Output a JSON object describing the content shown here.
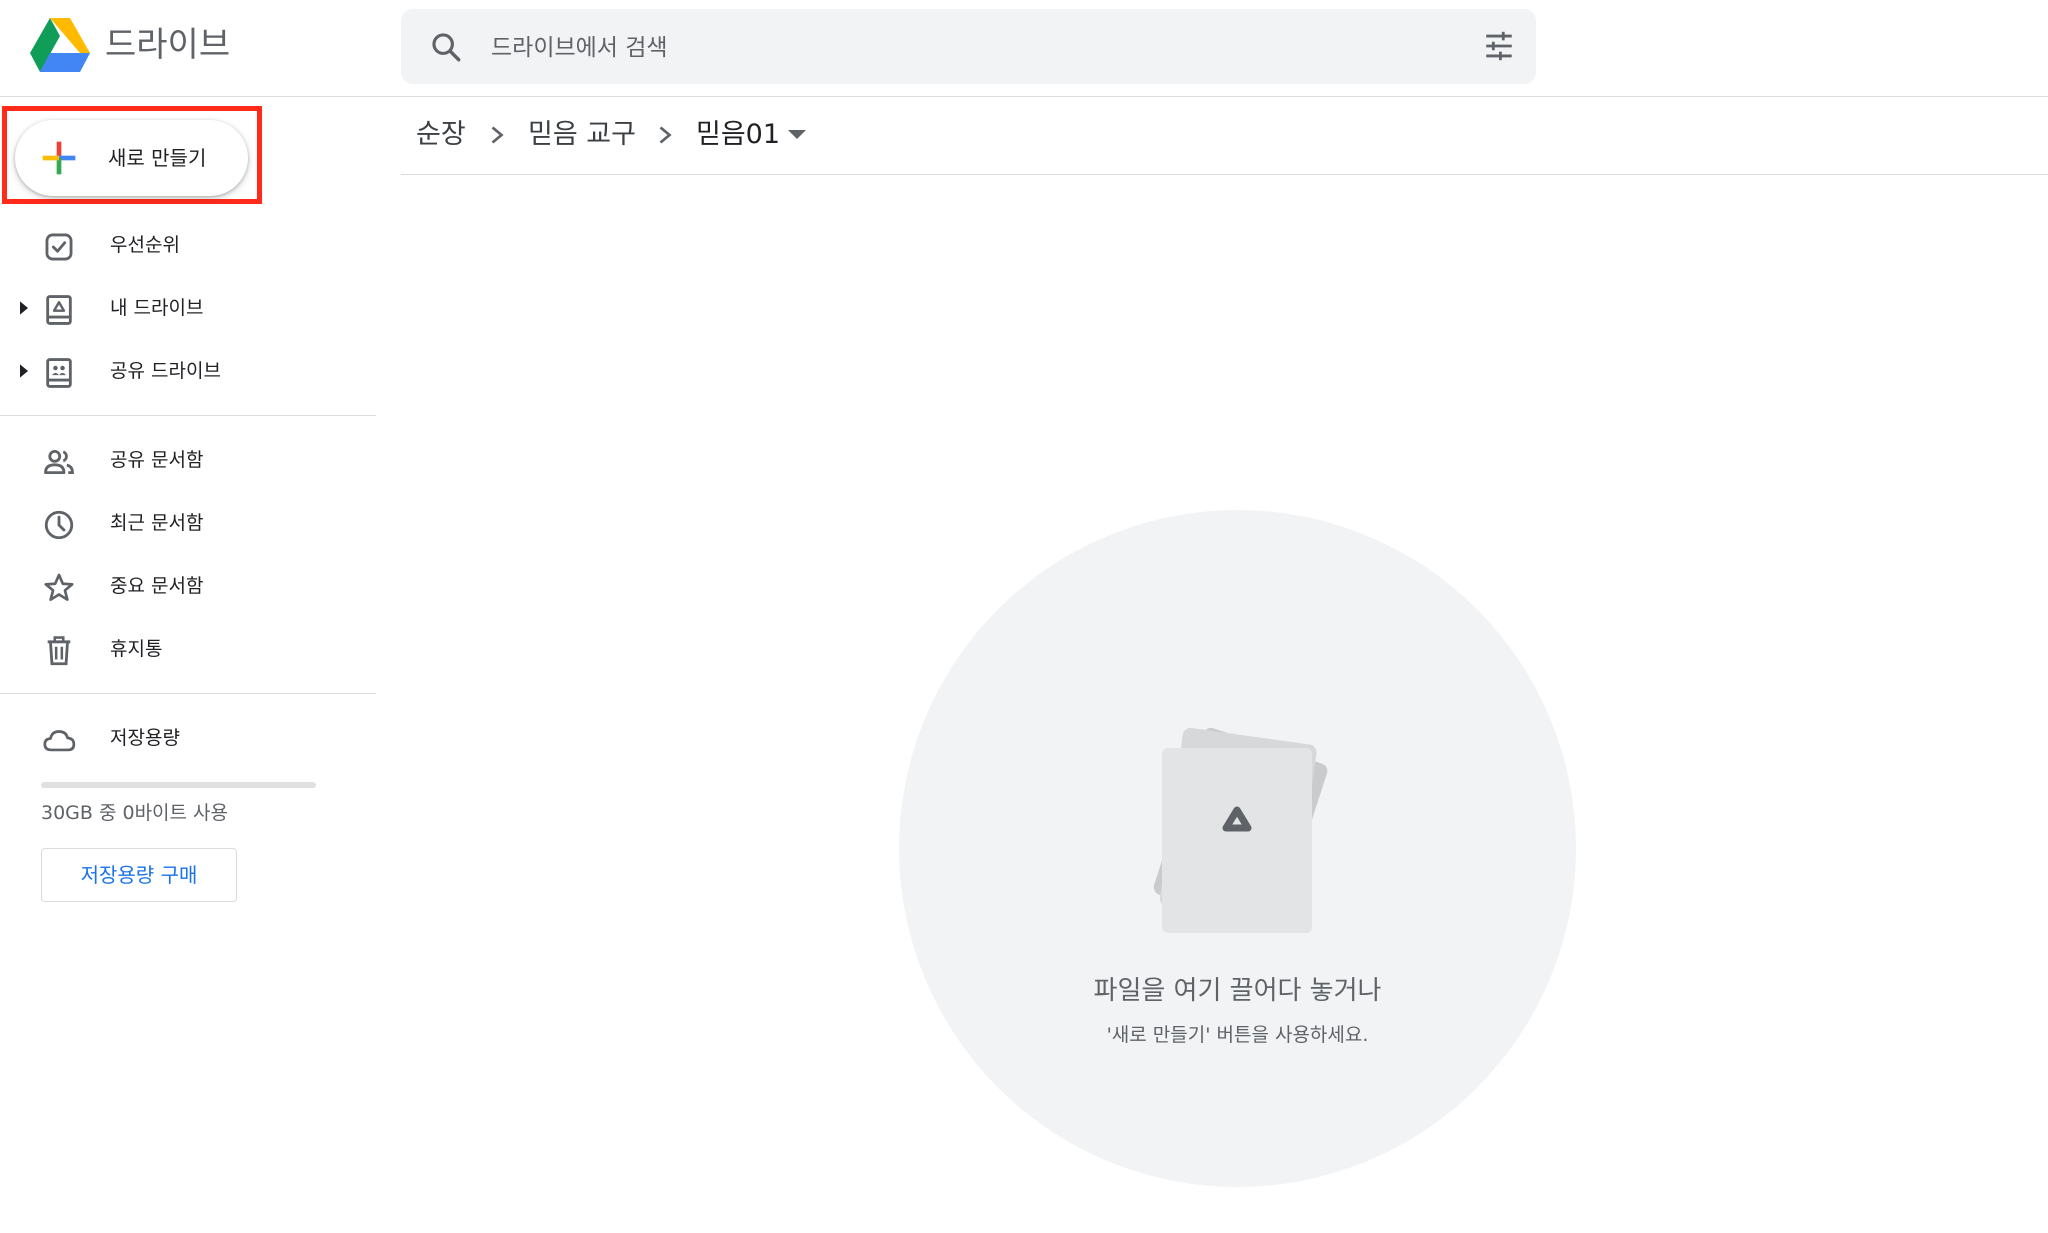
{
  "app": {
    "name": "드라이브"
  },
  "search": {
    "placeholder": "드라이브에서 검색"
  },
  "new_button": {
    "label": "새로 만들기"
  },
  "sidebar": {
    "items": [
      {
        "label": "우선순위",
        "icon": "priority-check-icon"
      },
      {
        "label": "내 드라이브",
        "icon": "my-drive-icon"
      },
      {
        "label": "공유 드라이브",
        "icon": "shared-drives-icon"
      },
      {
        "label": "공유 문서함",
        "icon": "people-icon"
      },
      {
        "label": "최근 문서함",
        "icon": "clock-icon"
      },
      {
        "label": "중요 문서함",
        "icon": "star-icon"
      },
      {
        "label": "휴지통",
        "icon": "trash-icon"
      },
      {
        "label": "저장용량",
        "icon": "cloud-icon"
      }
    ]
  },
  "storage": {
    "used_text": "30GB 중 0바이트 사용",
    "used_fraction": 0,
    "buy_label": "저장용량 구매"
  },
  "breadcrumb": {
    "items": [
      "순장",
      "믿음 교구",
      "믿음01"
    ]
  },
  "empty_state": {
    "title": "파일을 여기 끌어다 놓거나",
    "subtitle": "'새로 만들기' 버튼을 사용하세요."
  },
  "colors": {
    "highlight_border": "#ff2a1a",
    "accent_blue": "#1a73e8",
    "empty_circle": "#f1f3f4"
  }
}
